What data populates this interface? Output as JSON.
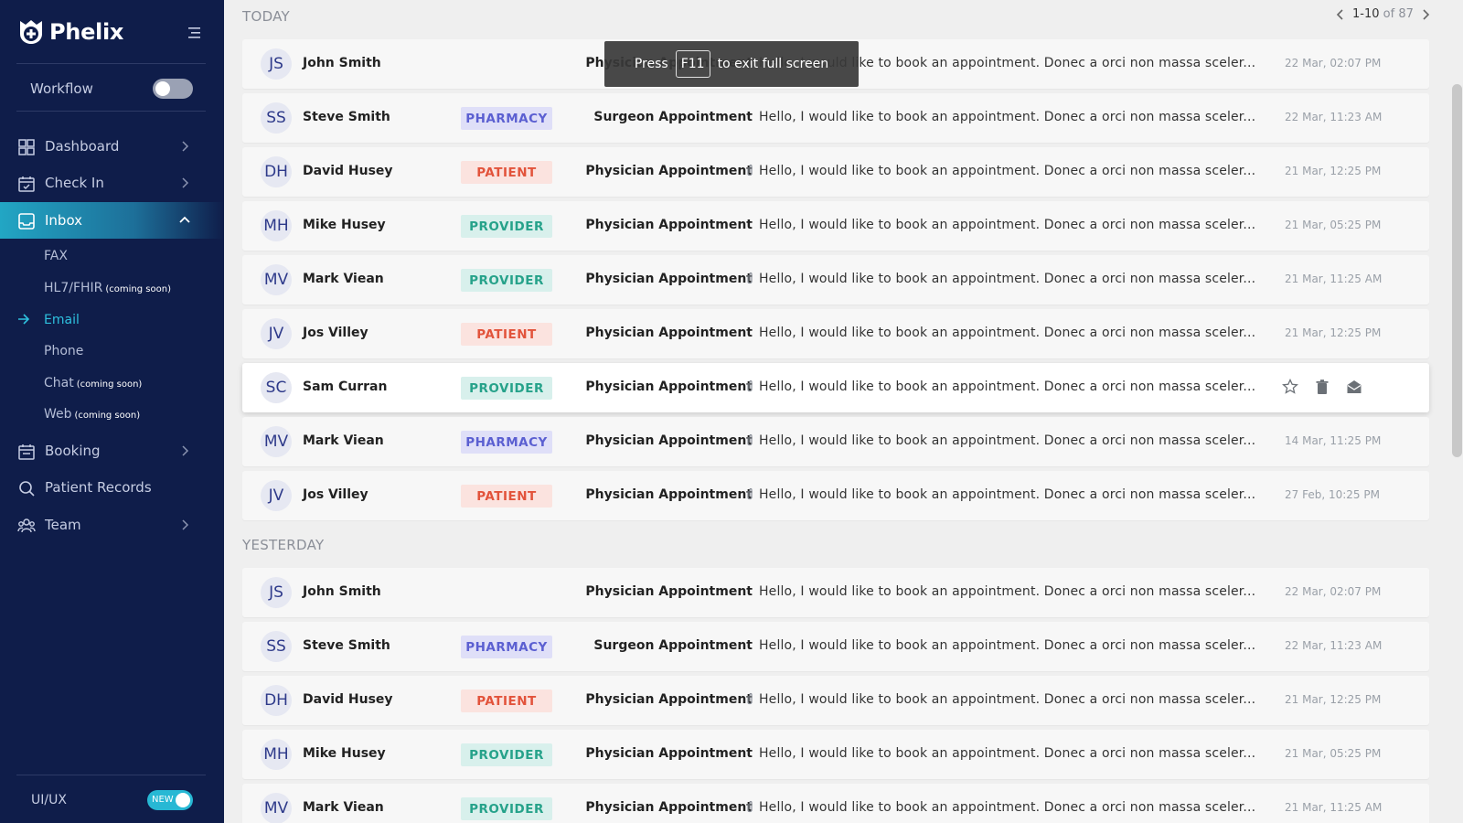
{
  "app": {
    "name": "Phelix"
  },
  "sidebar": {
    "workflow_label": "Workflow",
    "workflow_enabled": false,
    "nav": {
      "dashboard": "Dashboard",
      "checkin": "Check In",
      "inbox": "Inbox",
      "booking": "Booking",
      "patient_records": "Patient Records",
      "team": "Team"
    },
    "inbox_sub": {
      "fax": "FAX",
      "hl7": "HL7/FHIR",
      "hl7_note": "(coming soon)",
      "email": "Email",
      "phone": "Phone",
      "chat": "Chat",
      "chat_note": "(coming soon)",
      "web": "Web",
      "web_note": "(coming soon)"
    },
    "footer": {
      "label": "UI/UX",
      "toggle_text": "NEW",
      "toggle_enabled": true
    }
  },
  "pager": {
    "range": "1-10",
    "of": "of 87"
  },
  "fullscreen_notice": {
    "before": "Press",
    "key": "F11",
    "after": "to exit full screen"
  },
  "sections": [
    {
      "label": "TODAY",
      "messages": [
        {
          "initials": "JS",
          "sender": "John Smith",
          "tag": "",
          "subject": "Physician Appointment",
          "attachment": false,
          "preview": "Hello, I would like to book an appointment. Donec a orci non massa sceler...",
          "time": "22 Mar, 02:07 PM"
        },
        {
          "initials": "SS",
          "sender": "Steve Smith",
          "tag": "PHARMACY",
          "subject": "Surgeon Appointment",
          "attachment": false,
          "preview": "Hello, I would like to book an appointment. Donec a orci non massa sceler...",
          "time": "22 Mar, 11:23 AM"
        },
        {
          "initials": "DH",
          "sender": "David Husey",
          "tag": "PATIENT",
          "subject": "Physician Appointment",
          "attachment": true,
          "preview": "Hello, I would like to book an appointment. Donec a orci non massa sceler...",
          "time": "21 Mar, 12:25 PM"
        },
        {
          "initials": "MH",
          "sender": "Mike Husey",
          "tag": "PROVIDER",
          "subject": "Physician Appointment",
          "attachment": false,
          "preview": "Hello, I would like to book an appointment. Donec a orci non massa sceler...",
          "time": "21 Mar, 05:25 PM"
        },
        {
          "initials": "MV",
          "sender": "Mark Viean",
          "tag": "PROVIDER",
          "subject": "Physician Appointment",
          "attachment": true,
          "preview": "Hello, I would like to book an appointment. Donec a orci non massa sceler...",
          "time": "21 Mar, 11:25 AM"
        },
        {
          "initials": "JV",
          "sender": "Jos Villey",
          "tag": "PATIENT",
          "subject": "Physician Appointment",
          "attachment": false,
          "preview": "Hello, I would like to book an appointment. Donec a orci non massa sceler...",
          "time": "21 Mar, 12:25 PM"
        },
        {
          "initials": "SC",
          "sender": "Sam Curran",
          "tag": "PROVIDER",
          "subject": "Physician Appointment",
          "attachment": true,
          "preview": "Hello, I would like to book an appointment. Donec a orci non massa sceler...",
          "time": "",
          "hovered": true
        },
        {
          "initials": "MV",
          "sender": "Mark Viean",
          "tag": "PHARMACY",
          "subject": "Physician Appointment",
          "attachment": true,
          "preview": "Hello, I would like to book an appointment. Donec a orci non massa sceler...",
          "time": "14 Mar, 11:25 PM"
        },
        {
          "initials": "JV",
          "sender": "Jos Villey",
          "tag": "PATIENT",
          "subject": "Physician Appointment",
          "attachment": true,
          "preview": "Hello, I would like to book an appointment. Donec a orci non massa sceler...",
          "time": "27 Feb, 10:25 PM"
        }
      ]
    },
    {
      "label": "YESTERDAY",
      "messages": [
        {
          "initials": "JS",
          "sender": "John Smith",
          "tag": "",
          "subject": "Physician Appointment",
          "attachment": false,
          "preview": "Hello, I would like to book an appointment. Donec a orci non massa sceler...",
          "time": "22 Mar, 02:07 PM"
        },
        {
          "initials": "SS",
          "sender": "Steve Smith",
          "tag": "PHARMACY",
          "subject": "Surgeon Appointment",
          "attachment": false,
          "preview": "Hello, I would like to book an appointment. Donec a orci non massa sceler...",
          "time": "22 Mar, 11:23 AM"
        },
        {
          "initials": "DH",
          "sender": "David Husey",
          "tag": "PATIENT",
          "subject": "Physician Appointment",
          "attachment": true,
          "preview": "Hello, I would like to book an appointment. Donec a orci non massa sceler...",
          "time": "21 Mar, 12:25 PM"
        },
        {
          "initials": "MH",
          "sender": "Mike Husey",
          "tag": "PROVIDER",
          "subject": "Physician Appointment",
          "attachment": false,
          "preview": "Hello, I would like to book an appointment. Donec a orci non massa sceler...",
          "time": "21 Mar, 05:25 PM"
        },
        {
          "initials": "MV",
          "sender": "Mark Viean",
          "tag": "PROVIDER",
          "subject": "Physician Appointment",
          "attachment": true,
          "preview": "Hello, I would like to book an appointment. Donec a orci non massa sceler...",
          "time": "21 Mar, 11:25 AM"
        }
      ]
    }
  ],
  "colors": {
    "sidebar_bg": "#0f1d4a",
    "accent": "#27b8d4",
    "pharmacy": "#5b5fd1",
    "patient": "#e2533b",
    "provider": "#26a28a"
  },
  "icons": {
    "row_actions": [
      "star-icon",
      "trash-icon",
      "mark-read-icon"
    ]
  }
}
